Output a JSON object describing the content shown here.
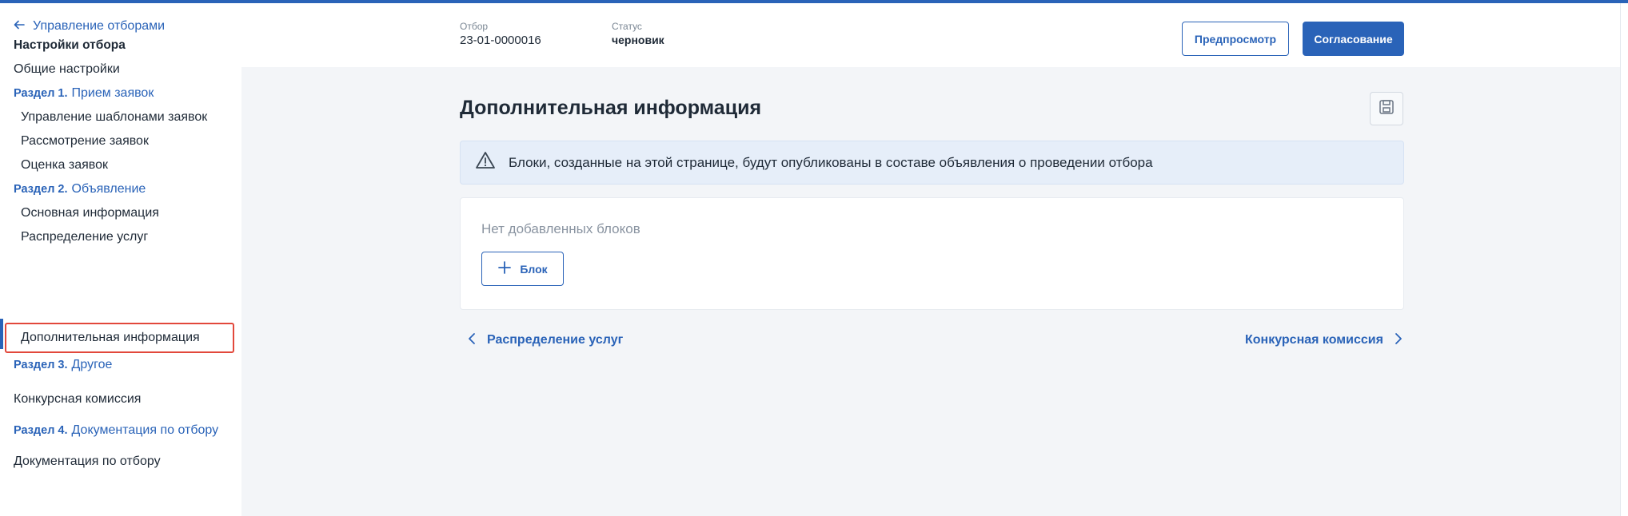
{
  "sidebar": {
    "back_label": "Управление отборами",
    "heading": "Настройки отбора",
    "general": "Общие настройки",
    "section1": {
      "num": "Раздел 1.",
      "title": "Прием заявок"
    },
    "s1_items": [
      "Управление шаблонами заявок",
      "Рассмотрение заявок",
      "Оценка заявок"
    ],
    "section2": {
      "num": "Раздел 2.",
      "title": "Объявление"
    },
    "s2_items": [
      "Основная информация",
      "Распределение услуг",
      "Дополнительная информация"
    ],
    "section3": {
      "num": "Раздел 3.",
      "title": "Другое"
    },
    "s3_items": [
      "Конкурсная комиссия"
    ],
    "section4": {
      "num": "Раздел 4.",
      "title": "Документация по отбору"
    },
    "s4_items": [
      "Документация по отбору"
    ]
  },
  "header": {
    "selection_label": "Отбор",
    "selection_value": "23-01-0000016",
    "status_label": "Статус",
    "status_value": "черновик",
    "preview_button": "Предпросмотр",
    "approve_button": "Согласование"
  },
  "main": {
    "title": "Дополнительная информация",
    "info_text": "Блоки, созданные на этой странице, будут опубликованы в составе объявления о проведении отбора",
    "empty_text": "Нет добавленных блоков",
    "add_block_button": "Блок",
    "prev_link": "Распределение услуг",
    "next_link": "Конкурсная комиссия"
  },
  "colors": {
    "accent": "#2a63b8",
    "highlight_border": "#e2483b",
    "background": "#f3f5f8",
    "info_bg": "#e6eef9"
  },
  "icons": [
    "arrow-left-icon",
    "save-icon",
    "warning-icon",
    "plus-icon",
    "chevron-left-icon",
    "chevron-right-icon"
  ]
}
